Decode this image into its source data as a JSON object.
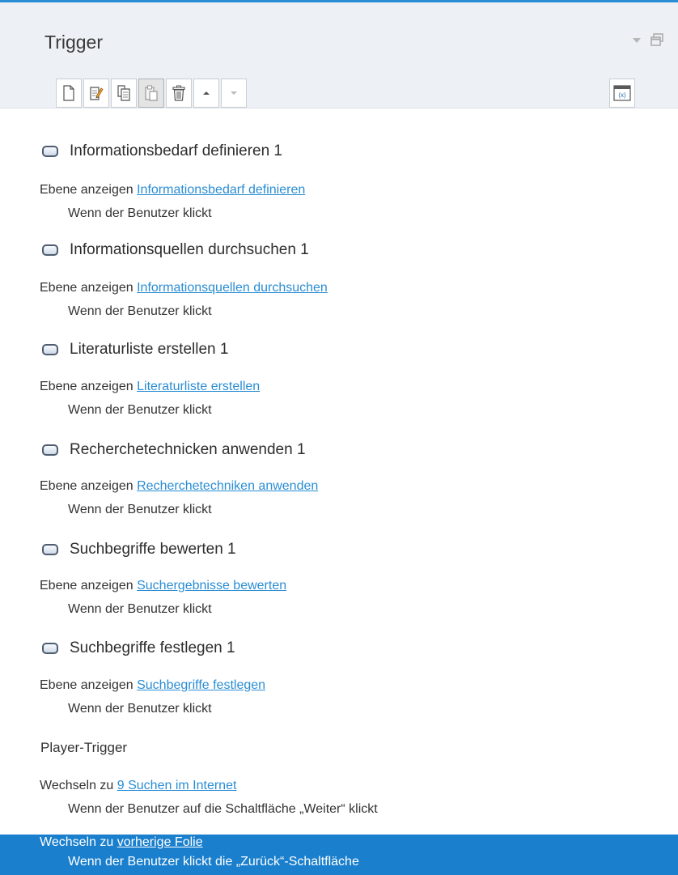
{
  "panel": {
    "title": "Trigger"
  },
  "triggers": [
    {
      "name": "Informationsbedarf definieren 1",
      "action": "Ebene anzeigen",
      "target": "Informationsbedarf definieren",
      "condition": "Wenn der Benutzer klickt"
    },
    {
      "name": "Informationsquellen durchsuchen 1",
      "action": "Ebene anzeigen",
      "target": "Informationsquellen durchsuchen",
      "condition": "Wenn der Benutzer klickt"
    },
    {
      "name": "Literaturliste erstellen 1",
      "action": "Ebene anzeigen",
      "target": "Literaturliste erstellen",
      "condition": "Wenn der Benutzer klickt"
    },
    {
      "name": "Recherchetechnicken anwenden 1",
      "action": "Ebene anzeigen",
      "target": "Recherchetechniken anwenden",
      "condition": "Wenn der Benutzer klickt"
    },
    {
      "name": "Suchbegriffe bewerten 1",
      "action": "Ebene anzeigen",
      "target": "Suchergebnisse bewerten",
      "condition": "Wenn der Benutzer klickt"
    },
    {
      "name": "Suchbegriffe festlegen 1",
      "action": "Ebene anzeigen",
      "target": " Suchbegriffe festlegen",
      "condition": "Wenn der Benutzer klickt"
    }
  ],
  "player": {
    "section_title": "Player-Trigger",
    "items": [
      {
        "action": "Wechseln zu",
        "target": "9 Suchen im Internet",
        "condition": "Wenn der Benutzer auf die Schaltfläche „Weiter“ klickt"
      },
      {
        "action": "Wechseln zu",
        "target": "vorherige Folie",
        "condition": "Wenn der Benutzer klickt die „Zurück“-Schaltfläche"
      }
    ]
  },
  "icons": {
    "toolbar": [
      "new-trigger-icon",
      "edit-trigger-icon",
      "copy-icon",
      "paste-icon",
      "delete-icon",
      "move-up-icon",
      "move-down-icon",
      "variables-icon"
    ],
    "header": [
      "dropdown-arrow-icon",
      "restore-window-icon"
    ]
  },
  "colors": {
    "accent": "#2a8dd4",
    "selected": "#1a7fcc",
    "header_bg": "#edf1f5"
  }
}
